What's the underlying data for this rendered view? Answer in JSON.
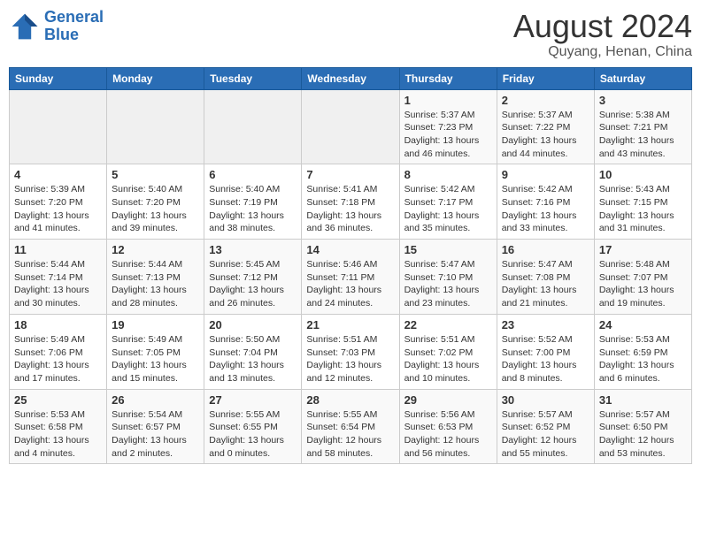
{
  "logo": {
    "line1": "General",
    "line2": "Blue"
  },
  "title": "August 2024",
  "subtitle": "Quyang, Henan, China",
  "weekdays": [
    "Sunday",
    "Monday",
    "Tuesday",
    "Wednesday",
    "Thursday",
    "Friday",
    "Saturday"
  ],
  "weeks": [
    [
      {
        "day": "",
        "info": ""
      },
      {
        "day": "",
        "info": ""
      },
      {
        "day": "",
        "info": ""
      },
      {
        "day": "",
        "info": ""
      },
      {
        "day": "1",
        "info": "Sunrise: 5:37 AM\nSunset: 7:23 PM\nDaylight: 13 hours\nand 46 minutes."
      },
      {
        "day": "2",
        "info": "Sunrise: 5:37 AM\nSunset: 7:22 PM\nDaylight: 13 hours\nand 44 minutes."
      },
      {
        "day": "3",
        "info": "Sunrise: 5:38 AM\nSunset: 7:21 PM\nDaylight: 13 hours\nand 43 minutes."
      }
    ],
    [
      {
        "day": "4",
        "info": "Sunrise: 5:39 AM\nSunset: 7:20 PM\nDaylight: 13 hours\nand 41 minutes."
      },
      {
        "day": "5",
        "info": "Sunrise: 5:40 AM\nSunset: 7:20 PM\nDaylight: 13 hours\nand 39 minutes."
      },
      {
        "day": "6",
        "info": "Sunrise: 5:40 AM\nSunset: 7:19 PM\nDaylight: 13 hours\nand 38 minutes."
      },
      {
        "day": "7",
        "info": "Sunrise: 5:41 AM\nSunset: 7:18 PM\nDaylight: 13 hours\nand 36 minutes."
      },
      {
        "day": "8",
        "info": "Sunrise: 5:42 AM\nSunset: 7:17 PM\nDaylight: 13 hours\nand 35 minutes."
      },
      {
        "day": "9",
        "info": "Sunrise: 5:42 AM\nSunset: 7:16 PM\nDaylight: 13 hours\nand 33 minutes."
      },
      {
        "day": "10",
        "info": "Sunrise: 5:43 AM\nSunset: 7:15 PM\nDaylight: 13 hours\nand 31 minutes."
      }
    ],
    [
      {
        "day": "11",
        "info": "Sunrise: 5:44 AM\nSunset: 7:14 PM\nDaylight: 13 hours\nand 30 minutes."
      },
      {
        "day": "12",
        "info": "Sunrise: 5:44 AM\nSunset: 7:13 PM\nDaylight: 13 hours\nand 28 minutes."
      },
      {
        "day": "13",
        "info": "Sunrise: 5:45 AM\nSunset: 7:12 PM\nDaylight: 13 hours\nand 26 minutes."
      },
      {
        "day": "14",
        "info": "Sunrise: 5:46 AM\nSunset: 7:11 PM\nDaylight: 13 hours\nand 24 minutes."
      },
      {
        "day": "15",
        "info": "Sunrise: 5:47 AM\nSunset: 7:10 PM\nDaylight: 13 hours\nand 23 minutes."
      },
      {
        "day": "16",
        "info": "Sunrise: 5:47 AM\nSunset: 7:08 PM\nDaylight: 13 hours\nand 21 minutes."
      },
      {
        "day": "17",
        "info": "Sunrise: 5:48 AM\nSunset: 7:07 PM\nDaylight: 13 hours\nand 19 minutes."
      }
    ],
    [
      {
        "day": "18",
        "info": "Sunrise: 5:49 AM\nSunset: 7:06 PM\nDaylight: 13 hours\nand 17 minutes."
      },
      {
        "day": "19",
        "info": "Sunrise: 5:49 AM\nSunset: 7:05 PM\nDaylight: 13 hours\nand 15 minutes."
      },
      {
        "day": "20",
        "info": "Sunrise: 5:50 AM\nSunset: 7:04 PM\nDaylight: 13 hours\nand 13 minutes."
      },
      {
        "day": "21",
        "info": "Sunrise: 5:51 AM\nSunset: 7:03 PM\nDaylight: 13 hours\nand 12 minutes."
      },
      {
        "day": "22",
        "info": "Sunrise: 5:51 AM\nSunset: 7:02 PM\nDaylight: 13 hours\nand 10 minutes."
      },
      {
        "day": "23",
        "info": "Sunrise: 5:52 AM\nSunset: 7:00 PM\nDaylight: 13 hours\nand 8 minutes."
      },
      {
        "day": "24",
        "info": "Sunrise: 5:53 AM\nSunset: 6:59 PM\nDaylight: 13 hours\nand 6 minutes."
      }
    ],
    [
      {
        "day": "25",
        "info": "Sunrise: 5:53 AM\nSunset: 6:58 PM\nDaylight: 13 hours\nand 4 minutes."
      },
      {
        "day": "26",
        "info": "Sunrise: 5:54 AM\nSunset: 6:57 PM\nDaylight: 13 hours\nand 2 minutes."
      },
      {
        "day": "27",
        "info": "Sunrise: 5:55 AM\nSunset: 6:55 PM\nDaylight: 13 hours\nand 0 minutes."
      },
      {
        "day": "28",
        "info": "Sunrise: 5:55 AM\nSunset: 6:54 PM\nDaylight: 12 hours\nand 58 minutes."
      },
      {
        "day": "29",
        "info": "Sunrise: 5:56 AM\nSunset: 6:53 PM\nDaylight: 12 hours\nand 56 minutes."
      },
      {
        "day": "30",
        "info": "Sunrise: 5:57 AM\nSunset: 6:52 PM\nDaylight: 12 hours\nand 55 minutes."
      },
      {
        "day": "31",
        "info": "Sunrise: 5:57 AM\nSunset: 6:50 PM\nDaylight: 12 hours\nand 53 minutes."
      }
    ]
  ]
}
